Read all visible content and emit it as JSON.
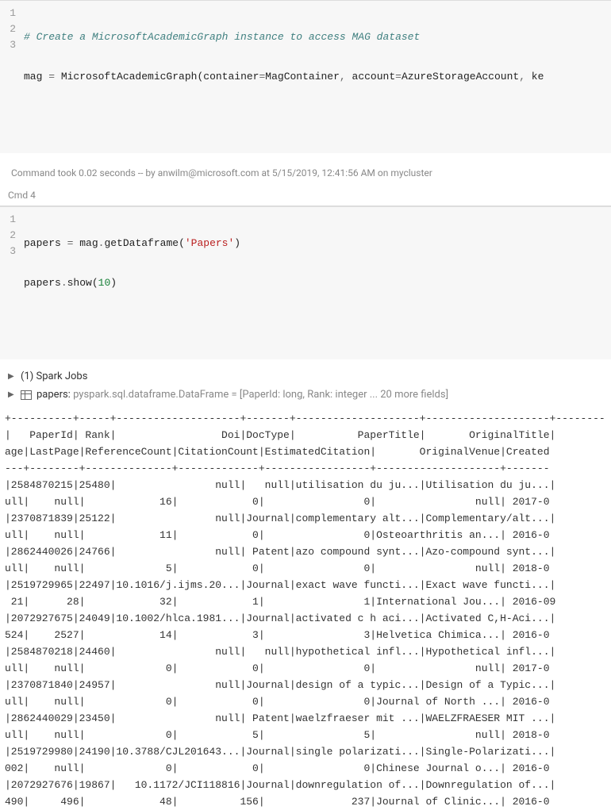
{
  "cell1": {
    "lines": [
      "1",
      "2",
      "3"
    ],
    "comment": "# Create a MicrosoftAcademicGraph instance to access MAG dataset",
    "var": "mag",
    "eq": " = ",
    "ctor": "MicrosoftAcademicGraph",
    "args_open": "(",
    "arg1k": "container",
    "arg1eq": "=",
    "arg1v": "MagContainer",
    "sep1": ", ",
    "arg2k": "account",
    "arg2eq": "=",
    "arg2v": "AzureStorageAccount",
    "sep2": ", ",
    "arg3k": "ke"
  },
  "exec": {
    "text": "Command took 0.02 seconds -- by anwilm@microsoft.com at 5/15/2019, 12:41:56 AM on mycluster"
  },
  "cell2_label": "Cmd 4",
  "cell2": {
    "lines": [
      "1",
      "2",
      "3"
    ],
    "l1_var": "papers",
    "l1_eq": " = ",
    "l1_obj": "mag",
    "l1_dot": ".",
    "l1_meth": "getDataframe",
    "l1_po": "(",
    "l1_str": "'Papers'",
    "l1_pc": ")",
    "l2_obj": "papers",
    "l2_dot": ".",
    "l2_meth": "show",
    "l2_po": "(",
    "l2_num": "10",
    "l2_pc": ")"
  },
  "output": {
    "spark_jobs": "(1) Spark Jobs",
    "df_name": "papers: ",
    "df_type": "pyspark.sql.dataframe.DataFrame = [PaperId: long, Rank: integer ... 20 more fields]"
  },
  "ascii": {
    "sep": "+----------+-----+--------------------+-------+--------------------+--------------------+--------",
    "hdr1": "|   PaperId| Rank|                 Doi|DocType|          PaperTitle|       OriginalTitle|",
    "hdr2": "age|LastPage|ReferenceCount|CitationCount|EstimatedCitation|       OriginalVenue|Created",
    "sep2": "---+--------+--------------+-------------+-----------------+--------------------+-------",
    "r1a": "|2584870215|25480|                null|   null|utilisation du ju...|Utilisation du ju...|",
    "r1b": "ull|    null|            16|            0|                0|                null| 2017-0",
    "r2a": "|2370871839|25122|                null|Journal|complementary alt...|Complementary/alt...|",
    "r2b": "ull|    null|            11|            0|                0|Osteoarthritis an...| 2016-0",
    "r3a": "|2862440026|24766|                null| Patent|azo compound synt...|Azo-compound synt...|",
    "r3b": "ull|    null|             5|            0|                0|                null| 2018-0",
    "r4a": "|2519729965|22497|10.1016/j.ijms.20...|Journal|exact wave functi...|Exact wave functi...|",
    "r4b": " 21|      28|            32|            1|                1|International Jou...| 2016-09",
    "r5a": "|2072927675|24049|10.1002/hlca.1981...|Journal|activated c h aci...|Activated C,H-Aci...|",
    "r5b": "524|    2527|            14|            3|                3|Helvetica Chimica...| 2016-0",
    "r6a": "|2584870218|24460|                null|   null|hypothetical infl...|Hypothetical infl...|",
    "r6b": "ull|    null|             0|            0|                0|                null| 2017-0",
    "r7a": "|2370871840|24957|                null|Journal|design of a typic...|Design of a Typic...|",
    "r7b": "ull|    null|             0|            0|                0|Journal of North ...| 2016-0",
    "r8a": "|2862440029|23450|                null| Patent|waelzfraeser mit ...|WAELZFRAESER MIT ...|",
    "r8b": "ull|    null|             0|            5|                5|                null| 2018-0",
    "r9a": "|2519729980|24190|10.3788/CJL201643...|Journal|single polarizati...|Single-Polarizati...|",
    "r9b": "002|    null|             0|            0|                0|Chinese Journal o...| 2016-0",
    "r10a": "|2072927676|19867|   10.1172/JCI118816|Journal|downregulation of...|Downregulation of...|",
    "r10b": "490|     496|            48|          156|              237|Journal of Clinic...| 2016-0"
  }
}
